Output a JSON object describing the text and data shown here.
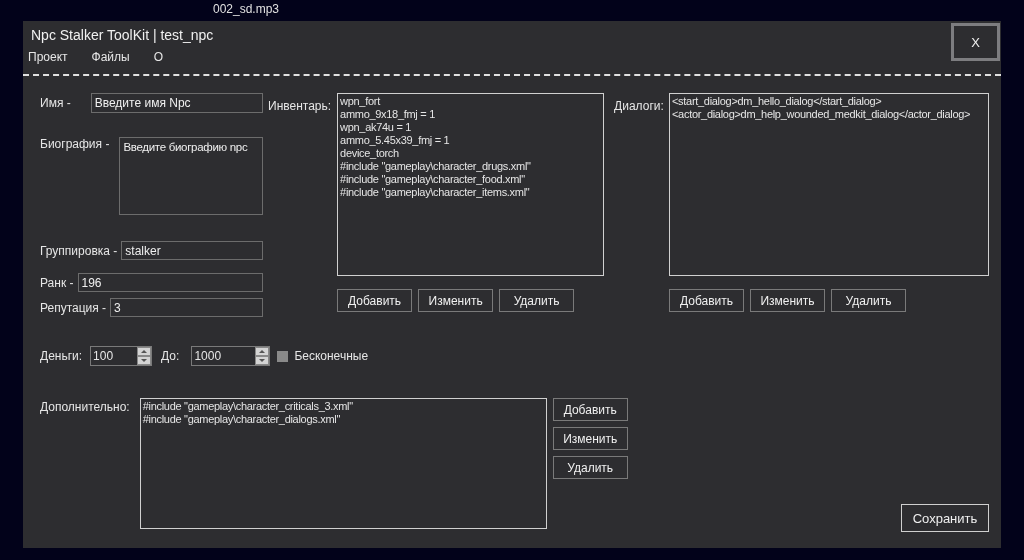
{
  "desktop": {
    "file_label": "002_sd.mp3"
  },
  "window": {
    "title": "Npc Stalker ToolKit | test_npc",
    "close": "X"
  },
  "menu": [
    "Проект",
    "Файлы",
    "О"
  ],
  "fields": {
    "name": {
      "label": "Имя -",
      "value": "Введите имя Npc"
    },
    "bio": {
      "label": "Биография -",
      "value": "Введите биографию npc"
    },
    "group": {
      "label": "Группировка -",
      "value": "stalker"
    },
    "rank": {
      "label": "Ранк -",
      "value": "196"
    },
    "reputation": {
      "label": "Репутация -",
      "value": "3"
    }
  },
  "inventory": {
    "label": "Инвентарь:",
    "items": [
      "wpn_fort",
      "ammo_9x18_fmj = 1",
      "wpn_ak74u = 1",
      "ammo_5.45x39_fmj = 1",
      "device_torch",
      "#include \"gameplay\\character_drugs.xml\"",
      "#include \"gameplay\\character_food.xml\"",
      "#include \"gameplay\\character_items.xml\""
    ],
    "buttons": [
      "Добавить",
      "Изменить",
      "Удалить"
    ]
  },
  "dialogs": {
    "label": "Диалоги:",
    "items": [
      "<start_dialog>dm_hello_dialog</start_dialog>",
      "<actor_dialog>dm_help_wounded_medkit_dialog</actor_dialog>"
    ],
    "buttons": [
      "Добавить",
      "Изменить",
      "Удалить"
    ]
  },
  "money": {
    "label": "Деньги:",
    "from": "100",
    "to_label": "До:",
    "to": "1000",
    "infinite": {
      "label": "Бесконечные",
      "checked": false
    }
  },
  "extra": {
    "label": "Дополнительно:",
    "items": [
      "#include \"gameplay\\character_criticals_3.xml\"",
      "#include \"gameplay\\character_dialogs.xml\""
    ],
    "buttons": [
      "Добавить",
      "Изменить",
      "Удалить"
    ]
  },
  "save_button": "Сохранить"
}
